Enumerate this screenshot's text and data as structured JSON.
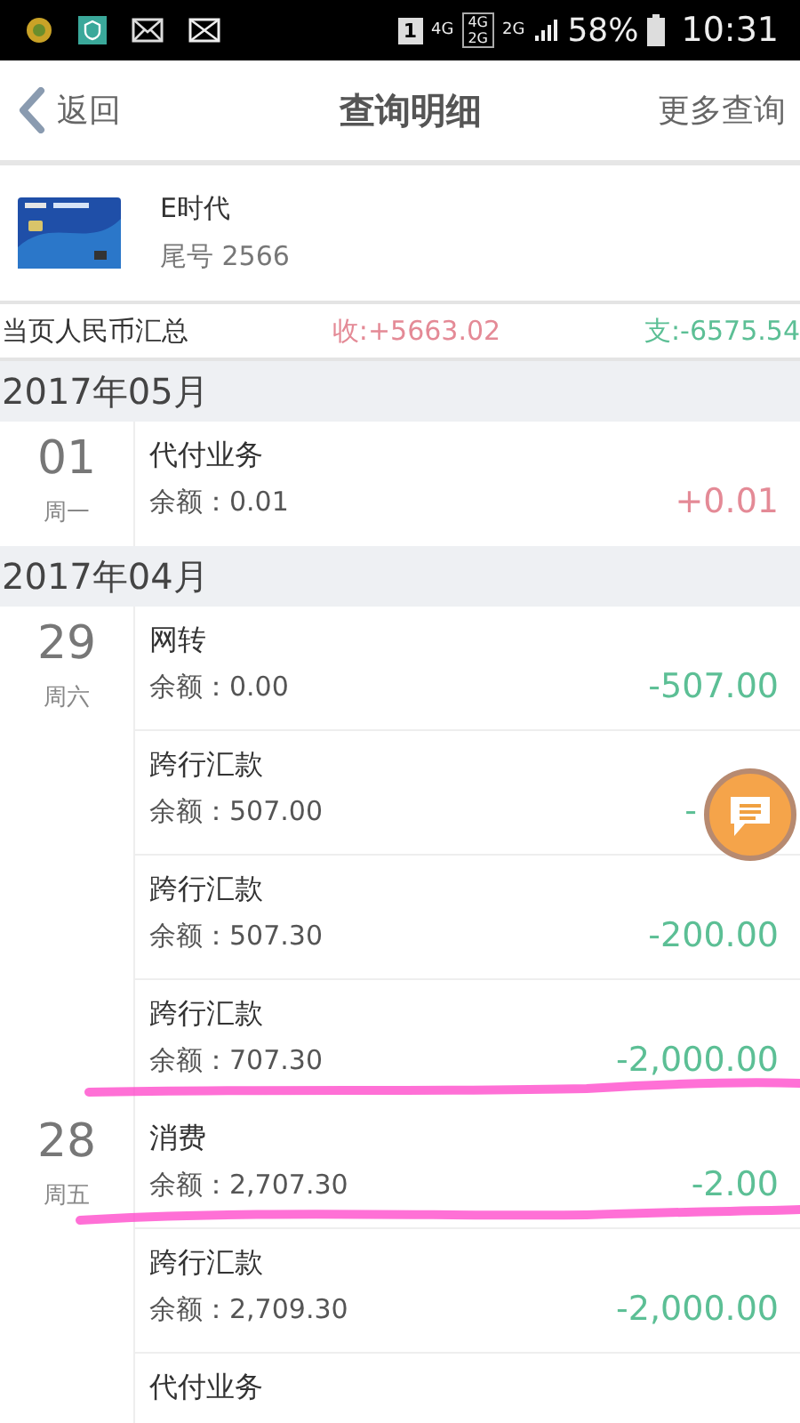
{
  "status_bar": {
    "sim": "1",
    "network": "4G",
    "dual_network": [
      "4G",
      "2G"
    ],
    "second_network": "2G",
    "battery": "58%",
    "time": "10:31"
  },
  "header": {
    "back": "返回",
    "title": "查询明细",
    "more": "更多查询"
  },
  "account": {
    "name": "E时代",
    "tail": "尾号 2566"
  },
  "summary": {
    "label": "当页人民币汇总",
    "income": "收:+5663.02",
    "expense": "支:-6575.54"
  },
  "months": [
    {
      "label": "2017年05月",
      "days": [
        {
          "day": "01",
          "weekday": "周一",
          "entries": [
            {
              "title": "代付业务",
              "balance": "余额：0.01",
              "amount": "+0.01",
              "kind": "credit"
            }
          ]
        }
      ]
    },
    {
      "label": "2017年04月",
      "days": [
        {
          "day": "29",
          "weekday": "周六",
          "entries": [
            {
              "title": "网转",
              "balance": "余额：0.00",
              "amount": "-507.00",
              "kind": "debit"
            },
            {
              "title": "跨行汇款",
              "balance": "余额：507.00",
              "amount": "-",
              "kind": "debit",
              "covered": true
            },
            {
              "title": "跨行汇款",
              "balance": "余额：507.30",
              "amount": "-200.00",
              "kind": "debit"
            },
            {
              "title": "跨行汇款",
              "balance": "余额：707.30",
              "amount": "-2,000.00",
              "kind": "debit"
            }
          ]
        },
        {
          "day": "28",
          "weekday": "周五",
          "entries": [
            {
              "title": "消费",
              "balance": "余额：2,707.30",
              "amount": "-2.00",
              "kind": "debit"
            },
            {
              "title": "跨行汇款",
              "balance": "余额：2,709.30",
              "amount": "-2,000.00",
              "kind": "debit"
            },
            {
              "title": "代付业务"
            }
          ]
        }
      ]
    }
  ]
}
